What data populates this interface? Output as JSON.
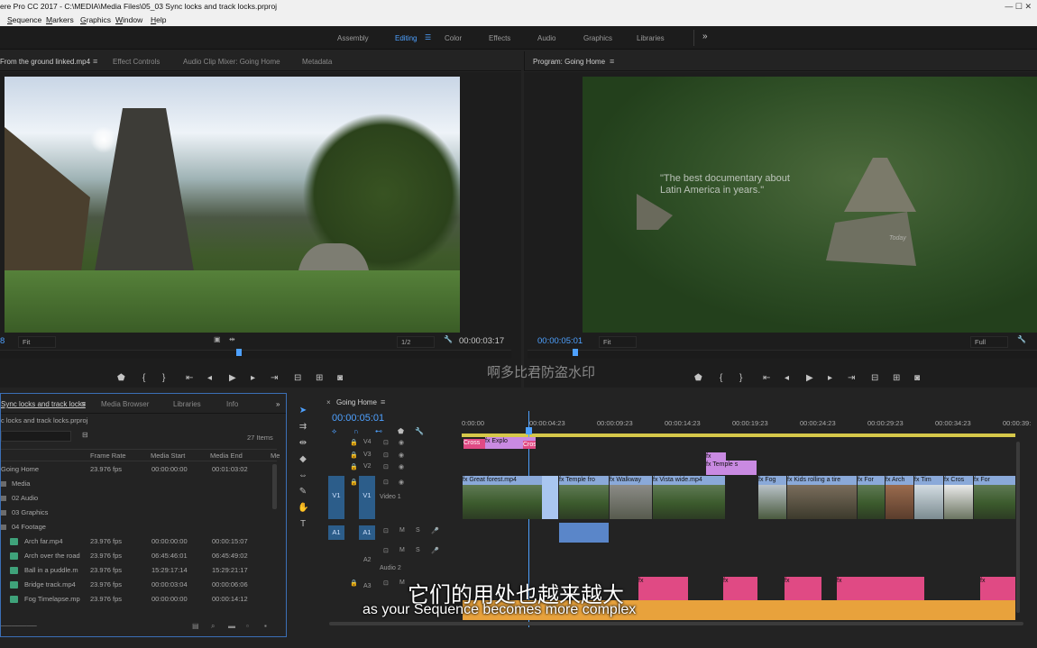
{
  "titlebar": {
    "title": "ere Pro CC 2017 - C:\\MEDIA\\Media Files\\05_03 Sync locks and track locks.prproj",
    "controls": "—  ☐  ✕"
  },
  "menu": [
    "Sequence",
    "Markers",
    "Graphics",
    "Window",
    "Help"
  ],
  "workspaces": {
    "items": [
      "Assembly",
      "Editing",
      "Color",
      "Effects",
      "Audio",
      "Graphics",
      "Libraries"
    ],
    "active": "Editing",
    "more": "»"
  },
  "source_panel": {
    "tabs": [
      "From the ground linked.mp4",
      "Effect Controls",
      "Audio Clip Mixer: Going Home",
      "Metadata"
    ],
    "timecode_left": "8",
    "fit": "Fit",
    "resolution": "1/2",
    "timecode_right": "00:00:03:17"
  },
  "program_panel": {
    "tab": "Program: Going Home",
    "timecode": "00:00:05:01",
    "fit": "Fit",
    "quality": "Full",
    "overlay_text_1": "\"The best documentary about",
    "overlay_text_2": "Latin America in years.\"",
    "overlay_small": "Today"
  },
  "project_panel": {
    "tabs": [
      "Sync locks and track locks",
      "Media Browser",
      "Libraries",
      "Info"
    ],
    "path": "c locks and track locks.prproj",
    "item_count": "27 Items",
    "columns": [
      "Frame Rate",
      "Media Start",
      "Media End",
      "Me"
    ],
    "rows": [
      {
        "name": "Going Home",
        "fps": "23.976 fps",
        "start": "00:00:00:00",
        "end": "00:01:03:02",
        "kind": "seq"
      },
      {
        "name": "Media",
        "fps": "",
        "start": "",
        "end": "",
        "kind": "bin"
      },
      {
        "name": "02 Audio",
        "fps": "",
        "start": "",
        "end": "",
        "kind": "bin"
      },
      {
        "name": "03 Graphics",
        "fps": "",
        "start": "",
        "end": "",
        "kind": "bin"
      },
      {
        "name": "04 Footage",
        "fps": "",
        "start": "",
        "end": "",
        "kind": "bin"
      },
      {
        "name": "Arch far.mp4",
        "fps": "23.976 fps",
        "start": "00:00:00:00",
        "end": "00:00:15:07",
        "kind": "clip"
      },
      {
        "name": "Arch over the road",
        "fps": "23.976 fps",
        "start": "06:45:46:01",
        "end": "06:45:49:02",
        "kind": "clip"
      },
      {
        "name": "Ball in a puddle.m",
        "fps": "23.976 fps",
        "start": "15:29:17:14",
        "end": "15:29:21:17",
        "kind": "clip"
      },
      {
        "name": "Bridge track.mp4",
        "fps": "23.976 fps",
        "start": "00:00:03:04",
        "end": "00:00:06:06",
        "kind": "clip"
      },
      {
        "name": "Fog Timelapse.mp",
        "fps": "23.976 fps",
        "start": "00:00:00:00",
        "end": "00:00:14:12",
        "kind": "clip"
      }
    ]
  },
  "timeline": {
    "tab": "Going Home",
    "timecode": "00:00:05:01",
    "ruler": [
      "0:00:00",
      "00:00:04:23",
      "00:00:09:23",
      "00:00:14:23",
      "00:00:19:23",
      "00:00:24:23",
      "00:00:29:23",
      "00:00:34:23",
      "00:00:39:"
    ],
    "tracks": {
      "v4": "V4",
      "v3": "V3",
      "v2": "V2",
      "v1": "V1",
      "v1_src": "V1",
      "video1": "Video 1",
      "a1": "A1",
      "a1_src": "A1",
      "a2": "A2",
      "audio2": "Audio 2",
      "a3": "A3"
    },
    "clips": {
      "cross1": "Cross",
      "explo": "fx  Explo",
      "cross2": "Cros",
      "temple_s": "fx  Temple s",
      "great_forest": "fx  Great forest.mp4",
      "temple_fro": "fx  Temple fro",
      "walkway": "fx  Walkway",
      "vista": "fx  Vista wide.mp4",
      "fog": "fx  Fog",
      "kids": "fx  Kids rolling a tire",
      "for1": "fx  For",
      "arch": "fx  Arch",
      "tim": "fx  Tim",
      "cros3": "fx  Cros",
      "for2": "fx  For"
    }
  },
  "subtitles": {
    "cn": "它们的用处也越来越大",
    "en": "as your Sequence becomes more complex"
  },
  "watermark": "啊多比君防盗水印"
}
